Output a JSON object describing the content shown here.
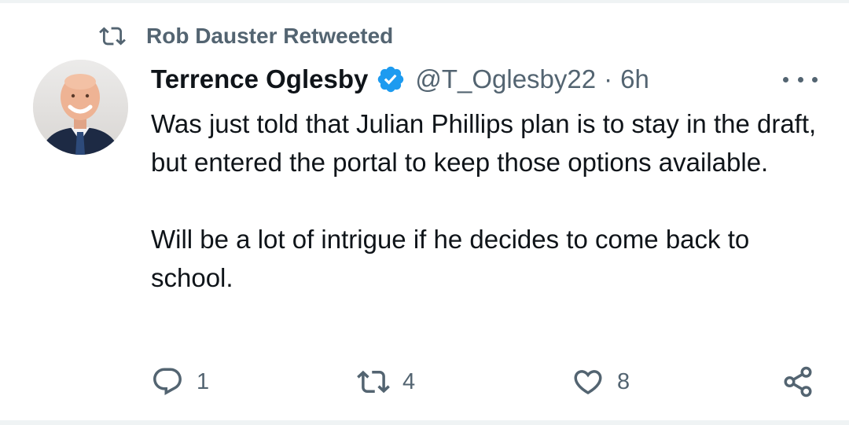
{
  "retweet_context": {
    "label": "Rob Dauster Retweeted",
    "icon": "retweet-icon"
  },
  "tweet": {
    "author_name": "Terrence Oglesby",
    "verified": true,
    "handle": "@T_Oglesby22",
    "separator": "·",
    "time": "6h",
    "paragraphs": [
      "Was just told that Julian Phillips plan is to stay in the draft, but entered the portal to keep those options available.",
      "Will be a lot of intrigue if he decides to come back to school."
    ]
  },
  "actions": {
    "reply_count": "1",
    "retweet_count": "4",
    "like_count": "8"
  },
  "colors": {
    "text": "#0f1419",
    "secondary": "#536471",
    "verified": "#1d9bf0"
  }
}
